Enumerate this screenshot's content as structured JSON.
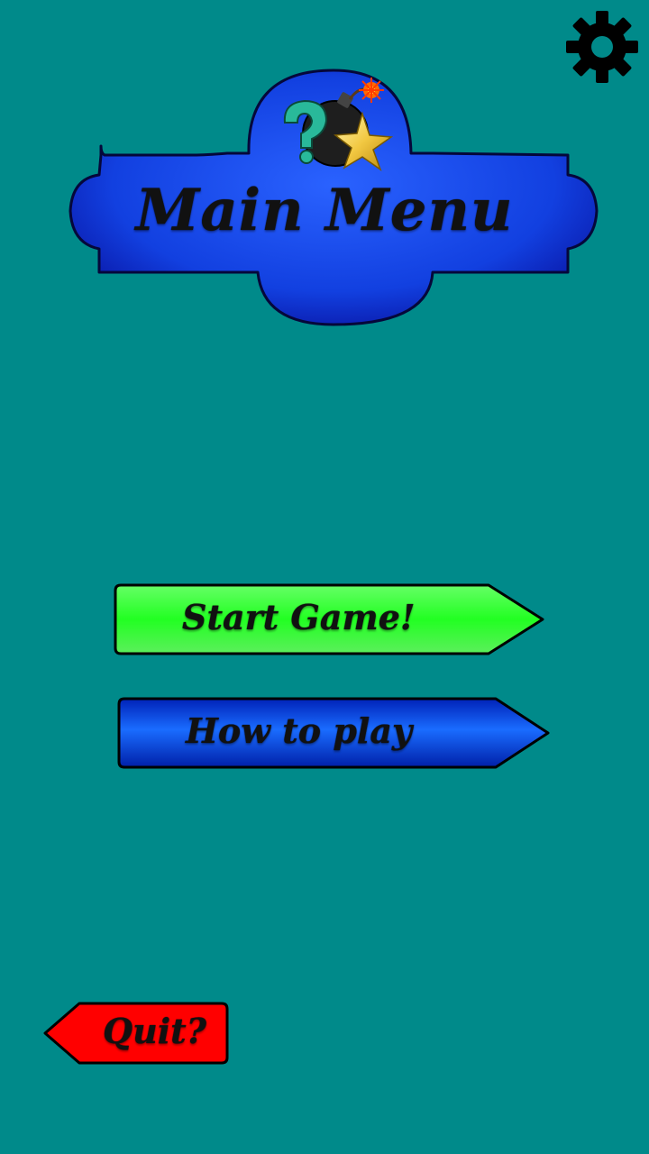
{
  "header": {
    "title": "Main Menu"
  },
  "menu": {
    "start_label": "Start Game!",
    "how_label": "How to play",
    "quit_label": "Quit?"
  },
  "icons": {
    "settings": "gear-icon",
    "logo": "bomb-question-star-icon"
  },
  "colors": {
    "background": "#008a8a",
    "banner": "#1a4de8",
    "start": "#33ff33",
    "how": "#0a3fe0",
    "quit": "#ff0000"
  }
}
